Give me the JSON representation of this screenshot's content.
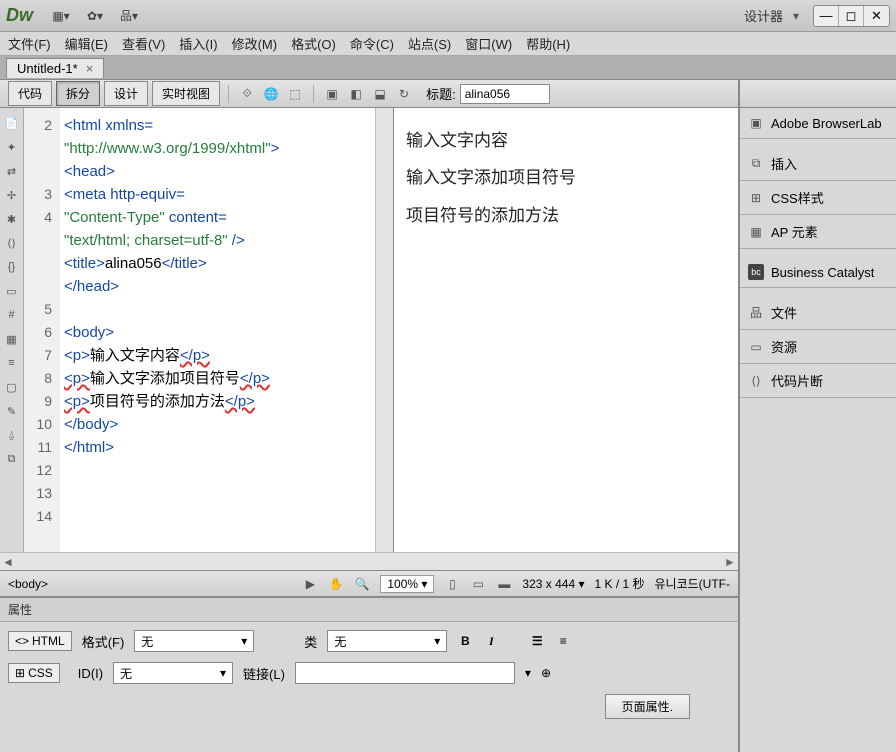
{
  "titlebar": {
    "logo": "Dw",
    "designer": "设计器",
    "dropdown": "▾"
  },
  "menubar": [
    "文件(F)",
    "编辑(E)",
    "查看(V)",
    "插入(I)",
    "修改(M)",
    "格式(O)",
    "命令(C)",
    "站点(S)",
    "窗口(W)",
    "帮助(H)"
  ],
  "doctab": {
    "name": "Untitled-1*",
    "close": "×"
  },
  "viewbtns": {
    "code": "代码",
    "split": "拆分",
    "design": "设计",
    "live": "实时视图"
  },
  "titlefield": {
    "label": "标题:",
    "value": "alina056"
  },
  "code": {
    "lines": [
      "2",
      "3",
      "4",
      "5",
      "6",
      "7",
      "8",
      "9",
      "10",
      "11",
      "12",
      "13",
      "14"
    ],
    "l2a": "<html xmlns=",
    "l2b": "\"http://www.w3.org/1999/xhtml\"",
    "l2c": ">",
    "l3": "<head>",
    "l4a": "<meta http-equiv=",
    "l4b": "\"Content-Type\"",
    "l4c": " content=",
    "l4d": "\"text/html; charset=utf-8\"",
    "l4e": " />",
    "l5": "<title>",
    "l5t": "alina056",
    "l5c": "</title>",
    "l6": "</head>",
    "l8": "<body>",
    "l9a": "<p>",
    "l9t": "输入文字内容",
    "l9b": "</p>",
    "l10a": "<p>",
    "l10t": "输入文字添加项目符号",
    "l10b": "</p>",
    "l11a": "<p>",
    "l11t": "项目符号的添加方法",
    "l11b": "</p>",
    "l12": "</body>",
    "l13": "</html>"
  },
  "preview": [
    "输入文字内容",
    "输入文字添加项目符号",
    "项目符号的添加方法"
  ],
  "statusbar": {
    "tag": "<body>",
    "zoom": "100%",
    "dim": "323 x 444",
    "size": "1 K / 1 秒",
    "enc": "유니코드(UTF-"
  },
  "props": {
    "title": "属性",
    "html": "HTML",
    "css": "CSS",
    "format": "格式(F)",
    "id": "ID(I)",
    "class": "类",
    "link": "链接(L)",
    "none": "无",
    "pagebtn": "页面属性."
  },
  "rpanel": {
    "browserlab": "Adobe BrowserLab",
    "insert": "插入",
    "css": "CSS样式",
    "ap": "AP 元素",
    "bc": "Business Catalyst",
    "files": "文件",
    "assets": "资源",
    "snippets": "代码片断"
  }
}
